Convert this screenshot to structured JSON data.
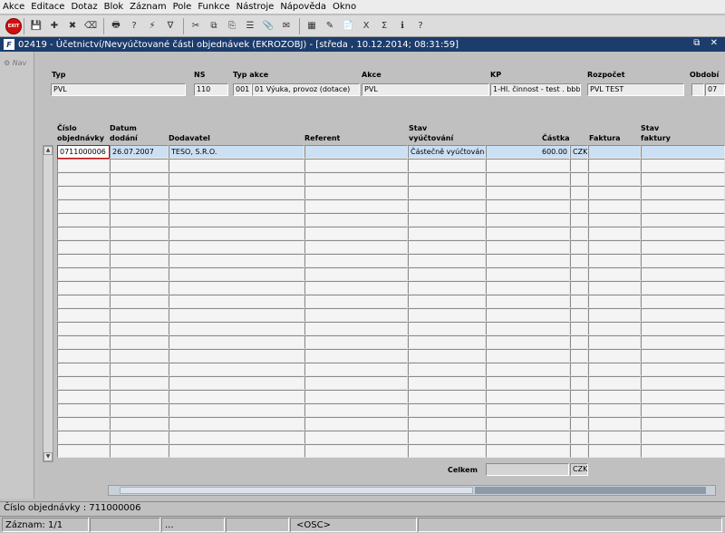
{
  "menu": [
    "Akce",
    "Editace",
    "Dotaz",
    "Blok",
    "Záznam",
    "Pole",
    "Funkce",
    "Nástroje",
    "Nápověda",
    "Okno"
  ],
  "toolbar": {
    "exit_label": "EXIT",
    "icons": [
      "save-icon",
      "new-record-icon",
      "delete-record-icon",
      "clear-icon",
      "print-icon",
      "enter-query-icon",
      "execute-query-icon",
      "filter-icon",
      "cut-icon",
      "copy-icon",
      "paste-icon",
      "list-icon",
      "attach-icon",
      "mail-icon",
      "calculator-icon",
      "note-icon",
      "report-icon",
      "excel-icon",
      "sum-icon",
      "info-icon",
      "help-icon"
    ],
    "glyphs": [
      "💾",
      "✚",
      "✖",
      "⌫",
      "🖶",
      "?",
      "⚡",
      "∇",
      "✂",
      "⧉",
      "⎘",
      "☰",
      "📎",
      "✉",
      "▦",
      "✎",
      "📄",
      "X",
      "Σ",
      "ℹ",
      "?"
    ]
  },
  "window": {
    "logo": "F",
    "title": "02419 - Účetnictví/Nevyúčtované části objednávek (EKROZOBJ) - [středa , 10.12.2014; 08:31:59]",
    "controls": "⧉ ✕"
  },
  "nav": {
    "label": "Nav"
  },
  "header": {
    "labels": {
      "typ": "Typ",
      "ns": "NS",
      "typ_akce": "Typ akce",
      "akce": "Akce",
      "kp": "KP",
      "rozpocet": "Rozpočet",
      "obdobi": "Období"
    },
    "values": {
      "typ": "PVL",
      "ns": "110",
      "typ_akce_code": "001",
      "typ_akce_name": "01 Výuka, provoz (dotace)",
      "akce": "PVL",
      "kp": "1-Hl. činnost - test . bbbb",
      "rozpocet": "PVL TEST",
      "obdobi_flag": "",
      "obdobi": "07"
    }
  },
  "grid": {
    "columns": {
      "cislo_l1": "Číslo",
      "cislo_l2": "objednávky",
      "datum_l1": "Datum",
      "datum_l2": "dodání",
      "dodavatel": "Dodavatel",
      "referent": "Referent",
      "stav_vyuct_l1": "Stav",
      "stav_vyuct_l2": "vyúčtování",
      "castka": "Částka",
      "faktura": "Faktura",
      "stav_fakt_l1": "Stav",
      "stav_fakt_l2": "faktury"
    },
    "rows": [
      {
        "cislo": "0711000006",
        "datum": "26.07.2007",
        "dodavatel": "TESO, S.R.O.",
        "referent": "",
        "stav": "Částečně vyúčtováno",
        "castka": "600.00",
        "mena": "CZK",
        "faktura": "",
        "stav_faktury": ""
      }
    ],
    "empty_rows": 22,
    "total_label": "Celkem",
    "total_value": "",
    "total_currency": "CZK"
  },
  "status": {
    "hint": "Číslo objednávky : 711000006",
    "record": "Záznam: 1/1",
    "part2": "",
    "part3": "...",
    "part4": "",
    "osc": "<OSC>",
    "part6": ""
  }
}
